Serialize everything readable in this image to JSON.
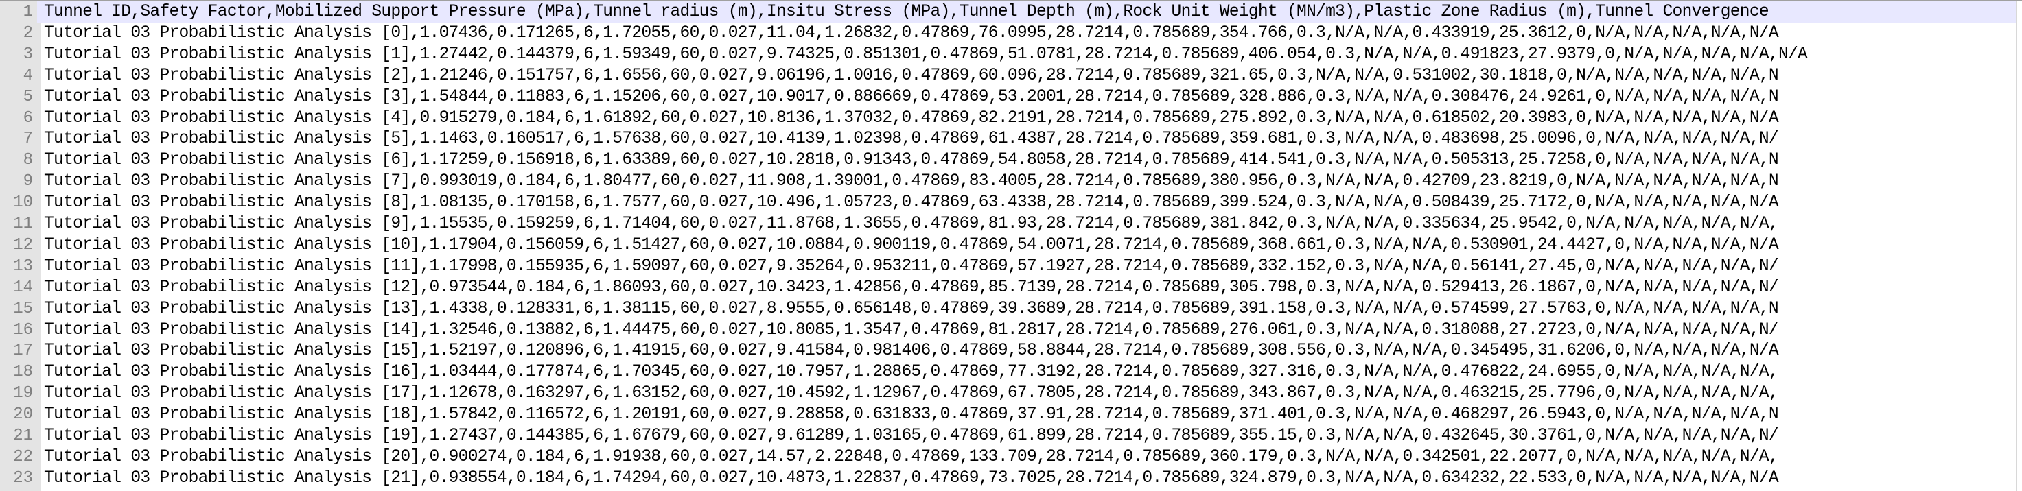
{
  "editor": {
    "current_line": 1,
    "lines": [
      "Tunnel ID,Safety Factor,Mobilized Support Pressure (MPa),Tunnel radius (m),Insitu Stress (MPa),Tunnel Depth (m),Rock Unit Weight (MN/m3),Plastic Zone Radius (m),Tunnel Convergence",
      "Tutorial 03 Probabilistic Analysis [0],1.07436,0.171265,6,1.72055,60,0.027,11.04,1.26832,0.47869,76.0995,28.7214,0.785689,354.766,0.3,N/A,N/A,0.433919,25.3612,0,N/A,N/A,N/A,N/A,N/A",
      "Tutorial 03 Probabilistic Analysis [1],1.27442,0.144379,6,1.59349,60,0.027,9.74325,0.851301,0.47869,51.0781,28.7214,0.785689,406.054,0.3,N/A,N/A,0.491823,27.9379,0,N/A,N/A,N/A,N/A,N/A",
      "Tutorial 03 Probabilistic Analysis [2],1.21246,0.151757,6,1.6556,60,0.027,9.06196,1.0016,0.47869,60.096,28.7214,0.785689,321.65,0.3,N/A,N/A,0.531002,30.1818,0,N/A,N/A,N/A,N/A,N/A,N",
      "Tutorial 03 Probabilistic Analysis [3],1.54844,0.11883,6,1.15206,60,0.027,10.9017,0.886669,0.47869,53.2001,28.7214,0.785689,328.886,0.3,N/A,N/A,0.308476,24.9261,0,N/A,N/A,N/A,N/A,N",
      "Tutorial 03 Probabilistic Analysis [4],0.915279,0.184,6,1.61892,60,0.027,10.8136,1.37032,0.47869,82.2191,28.7214,0.785689,275.892,0.3,N/A,N/A,0.618502,20.3983,0,N/A,N/A,N/A,N/A,N/A",
      "Tutorial 03 Probabilistic Analysis [5],1.1463,0.160517,6,1.57638,60,0.027,10.4139,1.02398,0.47869,61.4387,28.7214,0.785689,359.681,0.3,N/A,N/A,0.483698,25.0096,0,N/A,N/A,N/A,N/A,N/",
      "Tutorial 03 Probabilistic Analysis [6],1.17259,0.156918,6,1.63389,60,0.027,10.2818,0.91343,0.47869,54.8058,28.7214,0.785689,414.541,0.3,N/A,N/A,0.505313,25.7258,0,N/A,N/A,N/A,N/A,N",
      "Tutorial 03 Probabilistic Analysis [7],0.993019,0.184,6,1.80477,60,0.027,11.908,1.39001,0.47869,83.4005,28.7214,0.785689,380.956,0.3,N/A,N/A,0.42709,23.8219,0,N/A,N/A,N/A,N/A,N/A,N",
      "Tutorial 03 Probabilistic Analysis [8],1.08135,0.170158,6,1.7577,60,0.027,10.496,1.05723,0.47869,63.4338,28.7214,0.785689,399.524,0.3,N/A,N/A,0.508439,25.7172,0,N/A,N/A,N/A,N/A,N/A",
      "Tutorial 03 Probabilistic Analysis [9],1.15535,0.159259,6,1.71404,60,0.027,11.8768,1.3655,0.47869,81.93,28.7214,0.785689,381.842,0.3,N/A,N/A,0.335634,25.9542,0,N/A,N/A,N/A,N/A,N/A,",
      "Tutorial 03 Probabilistic Analysis [10],1.17904,0.156059,6,1.51427,60,0.027,10.0884,0.900119,0.47869,54.0071,28.7214,0.785689,368.661,0.3,N/A,N/A,0.530901,24.4427,0,N/A,N/A,N/A,N/A",
      "Tutorial 03 Probabilistic Analysis [11],1.17998,0.155935,6,1.59097,60,0.027,9.35264,0.953211,0.47869,57.1927,28.7214,0.785689,332.152,0.3,N/A,N/A,0.56141,27.45,0,N/A,N/A,N/A,N/A,N/",
      "Tutorial 03 Probabilistic Analysis [12],0.973544,0.184,6,1.86093,60,0.027,10.3423,1.42856,0.47869,85.7139,28.7214,0.785689,305.798,0.3,N/A,N/A,0.529413,26.1867,0,N/A,N/A,N/A,N/A,N/",
      "Tutorial 03 Probabilistic Analysis [13],1.4338,0.128331,6,1.38115,60,0.027,8.9555,0.656148,0.47869,39.3689,28.7214,0.785689,391.158,0.3,N/A,N/A,0.574599,27.5763,0,N/A,N/A,N/A,N/A,N",
      "Tutorial 03 Probabilistic Analysis [14],1.32546,0.13882,6,1.44475,60,0.027,10.8085,1.3547,0.47869,81.2817,28.7214,0.785689,276.061,0.3,N/A,N/A,0.318088,27.2723,0,N/A,N/A,N/A,N/A,N/",
      "Tutorial 03 Probabilistic Analysis [15],1.52197,0.120896,6,1.41915,60,0.027,9.41584,0.981406,0.47869,58.8844,28.7214,0.785689,308.556,0.3,N/A,N/A,0.345495,31.6206,0,N/A,N/A,N/A,N/A",
      "Tutorial 03 Probabilistic Analysis [16],1.03444,0.177874,6,1.70345,60,0.027,10.7957,1.28865,0.47869,77.3192,28.7214,0.785689,327.316,0.3,N/A,N/A,0.476822,24.6955,0,N/A,N/A,N/A,N/A,",
      "Tutorial 03 Probabilistic Analysis [17],1.12678,0.163297,6,1.63152,60,0.027,10.4592,1.12967,0.47869,67.7805,28.7214,0.785689,343.867,0.3,N/A,N/A,0.463215,25.7796,0,N/A,N/A,N/A,N/A,",
      "Tutorial 03 Probabilistic Analysis [18],1.57842,0.116572,6,1.20191,60,0.027,9.28858,0.631833,0.47869,37.91,28.7214,0.785689,371.401,0.3,N/A,N/A,0.468297,26.5943,0,N/A,N/A,N/A,N/A,N",
      "Tutorial 03 Probabilistic Analysis [19],1.27437,0.144385,6,1.67679,60,0.027,9.61289,1.03165,0.47869,61.899,28.7214,0.785689,355.15,0.3,N/A,N/A,0.432645,30.3761,0,N/A,N/A,N/A,N/A,N/",
      "Tutorial 03 Probabilistic Analysis [20],0.900274,0.184,6,1.91938,60,0.027,14.57,2.22848,0.47869,133.709,28.7214,0.785689,360.179,0.3,N/A,N/A,0.342501,22.2077,0,N/A,N/A,N/A,N/A,N/A,",
      "Tutorial 03 Probabilistic Analysis [21],0.938554,0.184,6,1.74294,60,0.027,10.4873,1.22837,0.47869,73.7025,28.7214,0.785689,324.879,0.3,N/A,N/A,0.634232,22.533,0,N/A,N/A,N/A,N/A,N/A"
    ]
  }
}
